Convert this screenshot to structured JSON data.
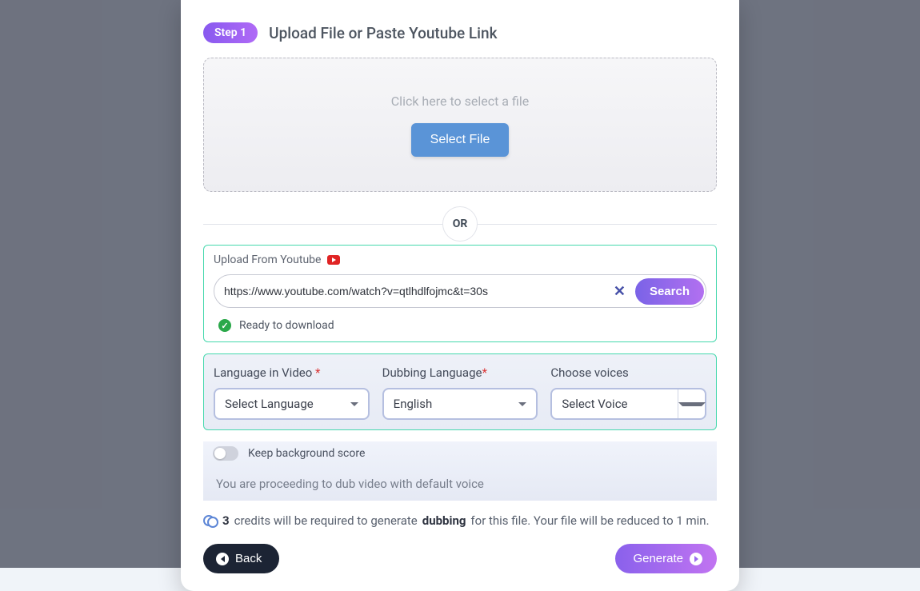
{
  "step": {
    "badge": "Step 1",
    "title": "Upload File or Paste Youtube Link"
  },
  "dropzone": {
    "hint": "Click here to select a file",
    "button": "Select File"
  },
  "divider": {
    "label": "OR"
  },
  "youtube": {
    "label": "Upload From Youtube",
    "url": "https://www.youtube.com/watch?v=qtlhdlfojmc&t=30s",
    "clear": "✕",
    "search": "Search",
    "ready": "Ready to download"
  },
  "languages": {
    "source_label": "Language in Video",
    "source_value": "Select Language",
    "target_label": "Dubbing Language",
    "target_value": "English",
    "voice_label": "Choose voices",
    "voice_value": "Select Voice",
    "required_mark": "*"
  },
  "options": {
    "bg_toggle_label": "Keep background score",
    "notice": "You are proceeding to dub video with default voice"
  },
  "credits": {
    "amount": "3",
    "pre": "credits will be required to generate",
    "mid_bold": "dubbing",
    "post": "for this file. Your file will be reduced to 1 min."
  },
  "footer": {
    "back": "Back",
    "generate": "Generate"
  }
}
